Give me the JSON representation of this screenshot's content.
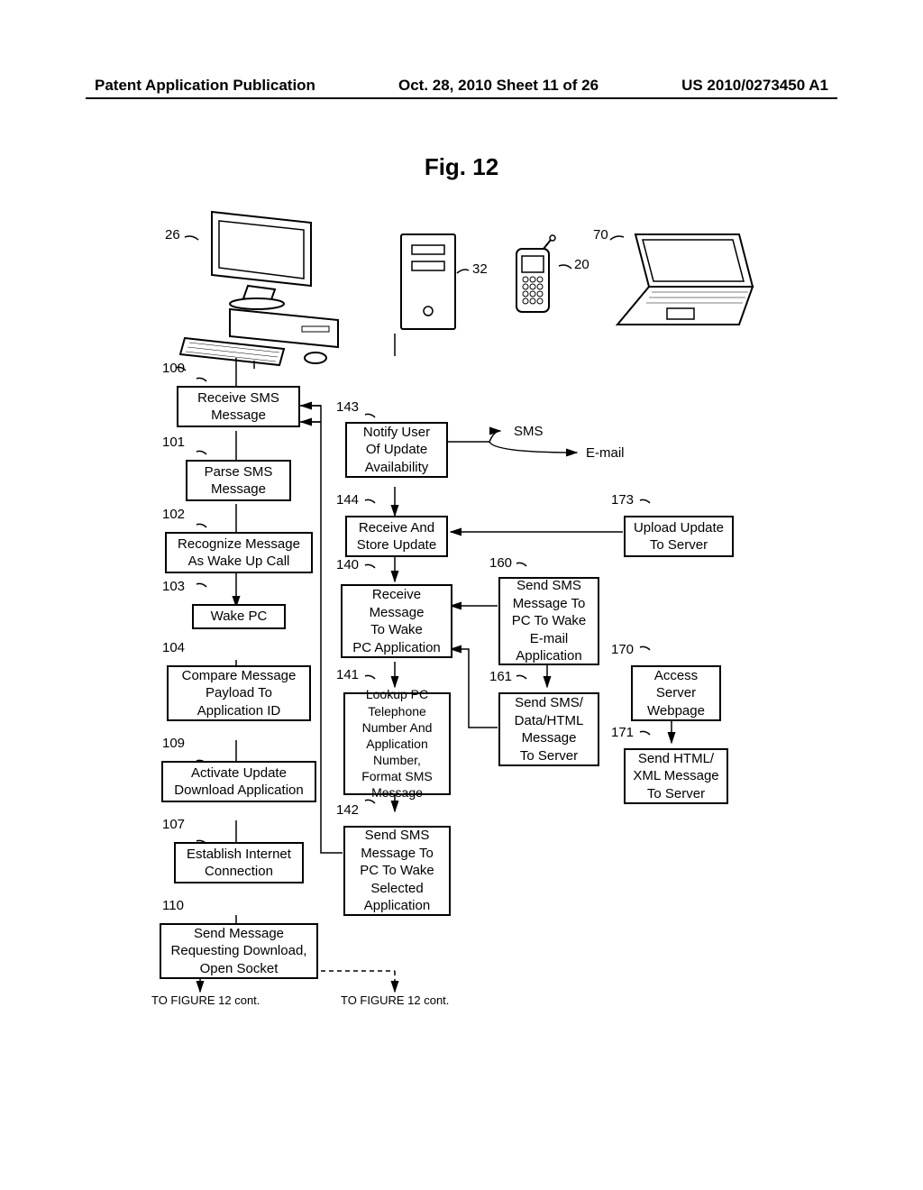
{
  "header": {
    "left": "Patent Application Publication",
    "center": "Oct. 28, 2010  Sheet 11 of 26",
    "right": "US 2010/0273450 A1"
  },
  "figure_title": "Fig. 12",
  "device_refs": {
    "r26": "26",
    "r32": "32",
    "r20": "20",
    "r70": "70"
  },
  "column_a": {
    "r100": "100",
    "b100": "Receive SMS\nMessage",
    "r101": "101",
    "b101": "Parse SMS\nMessage",
    "r102": "102",
    "b102": "Recognize Message\nAs Wake Up Call",
    "r103": "103",
    "b103": "Wake PC",
    "r104": "104",
    "b104": "Compare Message\nPayload To\nApplication ID",
    "r109": "109",
    "b109": "Activate Update\nDownload Application",
    "r107": "107",
    "b107": "Establish Internet\nConnection",
    "r110": "110",
    "b110": "Send Message\nRequesting Download,\nOpen Socket"
  },
  "column_b": {
    "r143": "143",
    "b143": "Notify User\nOf Update\nAvailability",
    "r144": "144",
    "b144": "Receive And\nStore Update",
    "r140": "140",
    "b140": "Receive\nMessage\nTo Wake\nPC Application",
    "r141": "141",
    "b141": "Lookup PC\nTelephone\nNumber And\nApplication Number,\nFormat SMS Message",
    "r142": "142",
    "b142": "Send SMS\nMessage To\nPC To Wake\nSelected\nApplication"
  },
  "column_c": {
    "r160": "160",
    "b160": "Send SMS\nMessage To\nPC To Wake\nE-mail\nApplication",
    "r161": "161",
    "b161": "Send SMS/\nData/HTML\nMessage\nTo Server"
  },
  "column_d": {
    "r173": "173",
    "b173": "Upload Update\nTo Server",
    "r170": "170",
    "b170": "Access\nServer\nWebpage",
    "r171": "171",
    "b171": "Send HTML/\nXML Message\nTo Server"
  },
  "side_labels": {
    "sms": "SMS",
    "email": "E-mail"
  },
  "footers": {
    "f1": "TO FIGURE 12 cont.",
    "f2": "TO FIGURE 12 cont."
  },
  "chart_data": {
    "type": "flowchart",
    "devices": [
      {
        "id": 26,
        "type": "desktop-pc"
      },
      {
        "id": 32,
        "type": "server-tower"
      },
      {
        "id": 20,
        "type": "mobile-phone"
      },
      {
        "id": 70,
        "type": "laptop"
      }
    ],
    "lanes": {
      "pc_26": [
        {
          "id": 100,
          "label": "Receive SMS Message"
        },
        {
          "id": 101,
          "label": "Parse SMS Message"
        },
        {
          "id": 102,
          "label": "Recognize Message As Wake Up Call"
        },
        {
          "id": 103,
          "label": "Wake PC"
        },
        {
          "id": 104,
          "label": "Compare Message Payload To Application ID"
        },
        {
          "id": 109,
          "label": "Activate Update Download Application"
        },
        {
          "id": 107,
          "label": "Establish Internet Connection"
        },
        {
          "id": 110,
          "label": "Send Message Requesting Download, Open Socket"
        }
      ],
      "server_32": [
        {
          "id": 143,
          "label": "Notify User Of Update Availability"
        },
        {
          "id": 144,
          "label": "Receive And Store Update"
        },
        {
          "id": 140,
          "label": "Receive Message To Wake PC Application"
        },
        {
          "id": 141,
          "label": "Lookup PC Telephone Number And Application Number, Format SMS Message"
        },
        {
          "id": 142,
          "label": "Send SMS Message To PC To Wake Selected Application"
        }
      ],
      "phone_20": [
        {
          "id": 160,
          "label": "Send SMS Message To PC To Wake E-mail Application"
        },
        {
          "id": 161,
          "label": "Send SMS/ Data/HTML Message To Server"
        }
      ],
      "laptop_70": [
        {
          "id": 173,
          "label": "Upload Update To Server"
        },
        {
          "id": 170,
          "label": "Access Server Webpage"
        },
        {
          "id": 171,
          "label": "Send HTML/ XML Message To Server"
        }
      ]
    },
    "edges": [
      {
        "from": 100,
        "to": 101
      },
      {
        "from": 101,
        "to": 102
      },
      {
        "from": 102,
        "to": 103
      },
      {
        "from": 103,
        "to": 104
      },
      {
        "from": 104,
        "to": 109
      },
      {
        "from": 109,
        "to": 107
      },
      {
        "from": 107,
        "to": 110
      },
      {
        "from": 110,
        "to": "TO FIGURE 12 cont."
      },
      {
        "from": 143,
        "to": 144
      },
      {
        "from": 143,
        "to": "SMS",
        "type": "branch"
      },
      {
        "from": 143,
        "to": "E-mail",
        "type": "branch"
      },
      {
        "from": 144,
        "to": 140
      },
      {
        "from": 140,
        "to": 141
      },
      {
        "from": 141,
        "to": 142
      },
      {
        "from": 142,
        "to": 100
      },
      {
        "from": 160,
        "to": 140
      },
      {
        "from": 161,
        "to": 140
      },
      {
        "from": 160,
        "to": 161
      },
      {
        "from": 173,
        "to": 144
      },
      {
        "from": 170,
        "to": 171
      },
      {
        "from": 171,
        "to": 140
      },
      {
        "from": 110,
        "to": "TO FIGURE 12 cont.",
        "lane": "server_32",
        "style": "dashed"
      }
    ]
  }
}
